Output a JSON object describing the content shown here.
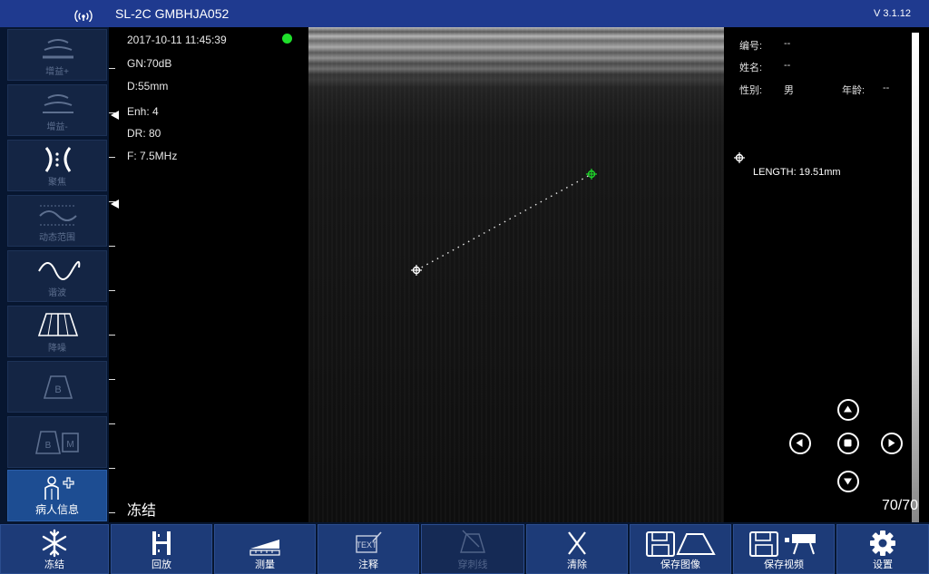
{
  "title_bar": {
    "device_name": "SL-2C GMBHJA052",
    "version": "V 3.1.12",
    "wifi_icon": "wifi-icon"
  },
  "sidebar": {
    "items": [
      {
        "label": "增益+",
        "icon": "gain-plus-icon",
        "enabled": false
      },
      {
        "label": "增益-",
        "icon": "gain-minus-icon",
        "enabled": false
      },
      {
        "label": "聚焦",
        "icon": "focus-icon",
        "enabled": false
      },
      {
        "label": "动态范围",
        "icon": "dynamic-range-icon",
        "enabled": false
      },
      {
        "label": "谐波",
        "icon": "harmonic-icon",
        "enabled": false
      },
      {
        "label": "降噪",
        "icon": "denoise-icon",
        "enabled": false
      },
      {
        "label": "",
        "icon": "b-mode-icon",
        "enabled": false
      },
      {
        "label": "",
        "icon": "bm-mode-icon",
        "enabled": false
      },
      {
        "label": "病人信息",
        "icon": "patient-info-icon",
        "enabled": true
      }
    ]
  },
  "scan_info": {
    "datetime": "2017-10-11 11:45:39",
    "gain": "GN:70dB",
    "depth": "D:55mm",
    "enhancement": "Enh: 4",
    "dynamic_range": "DR: 80",
    "frequency": "F: 7.5MHz",
    "status_color": "#1fe02b",
    "state_label": "冻结"
  },
  "patient": {
    "id_label": "编号:",
    "id_value": "--",
    "name_label": "姓名:",
    "name_value": "--",
    "sex_label": "性别:",
    "sex_value": "男",
    "age_label": "年龄:",
    "age_value": "--"
  },
  "measurement": {
    "length_text": "LENGTH: 19.51mm",
    "active_color": "#1fd62a"
  },
  "frame_counter": "70/70",
  "toolbar": {
    "items": [
      {
        "label": "冻结",
        "icon": "snowflake-icon",
        "enabled": true
      },
      {
        "label": "回放",
        "icon": "playback-icon",
        "enabled": true
      },
      {
        "label": "测量",
        "icon": "measure-icon",
        "enabled": true
      },
      {
        "label": "注释",
        "icon": "annotation-icon",
        "enabled": true
      },
      {
        "label": "穿刺线",
        "icon": "puncture-line-icon",
        "enabled": false
      },
      {
        "label": "清除",
        "icon": "clear-icon",
        "enabled": true
      },
      {
        "label": "保存图像",
        "icon": "save-image-icon",
        "enabled": true
      },
      {
        "label": "保存视频",
        "icon": "save-video-icon",
        "enabled": true
      },
      {
        "label": "设置",
        "icon": "settings-icon",
        "enabled": true
      }
    ]
  }
}
